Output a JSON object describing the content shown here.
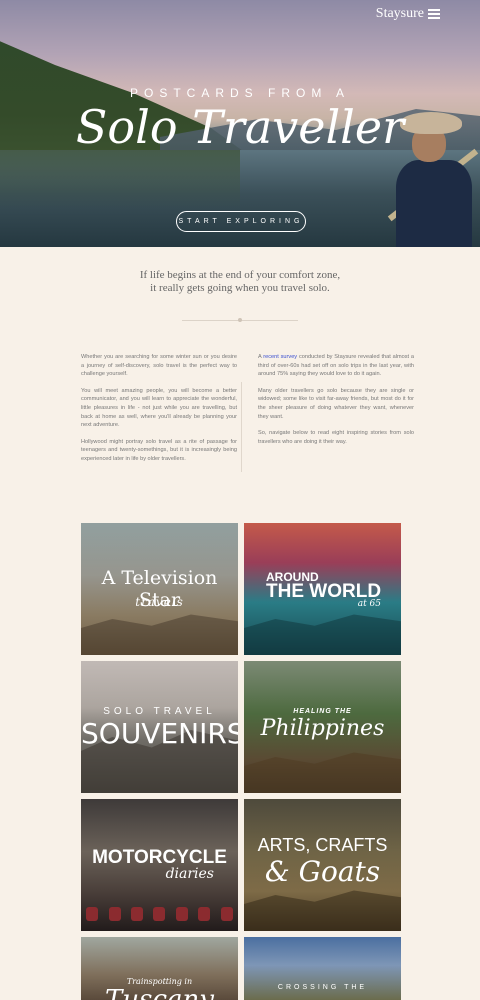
{
  "header": {
    "brand": "Staysure",
    "menu_icon": "hamburger-menu-icon"
  },
  "hero": {
    "kicker": "POSTCARDS FROM A",
    "title": "Solo Traveller",
    "cta_label": "START EXPLORING"
  },
  "intro": {
    "line1": "If life begins at the end of your comfort zone,",
    "line2": "it really gets going when you travel solo."
  },
  "body": {
    "left": [
      "Whether you are searching for some winter sun or you desire a journey of self-discovery, solo travel is the perfect way to challenge yourself.",
      "You will meet amazing people, you will become a better communicator, and you will learn to appreciate the wonderful, little pleasures in life - not just while you are travelling, but back at home as well, where you'll already be planning your next adventure.",
      "Hollywood might portray solo travel as a rite of passage for teenagers and twenty-somethings, but it is increasingly being experienced later in life by older travellers."
    ],
    "right_first_prefix": "A",
    "right_first_link": "recent survey",
    "right_first_rest": "conducted by Staysure revealed that almost a third of over-60s had set off on solo trips in the last year, with around 75% saying they would love to do it again.",
    "right": [
      "Many older travellers go solo because they are single or widowed; some like to visit far-away friends, but most do it for the sheer pleasure of doing whatever they want, whenever they want.",
      "So, navigate below to read eight inspiring stories from solo travellers who are doing it their way."
    ]
  },
  "tiles": [
    {
      "line1": "A Television Star",
      "line2": "travels"
    },
    {
      "line1": "AROUND",
      "line2": "THE WORLD",
      "line3": "at 65"
    },
    {
      "line1": "SOLO TRAVEL",
      "line2": "SOUVENIRS"
    },
    {
      "line1": "HEALING THE",
      "line2": "Philippines"
    },
    {
      "line1": "MOTORCYCLE",
      "line2": "diaries"
    },
    {
      "line1": "ARTS, CRAFTS",
      "line2": "& Goats"
    },
    {
      "line1": "Trainspotting in",
      "line2": "Tuscany"
    },
    {
      "line1": "CROSSING THE",
      "line2": ""
    }
  ]
}
